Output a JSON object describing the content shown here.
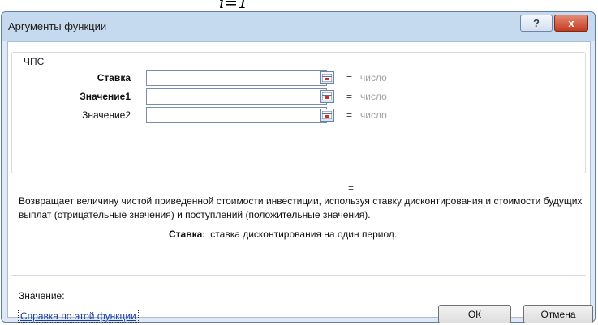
{
  "top_fragment": "i=1",
  "window": {
    "title": "Аргументы функции",
    "help_label": "?",
    "close_label": "x"
  },
  "function_group": {
    "name": "ЧПС",
    "arguments": [
      {
        "label": "Ставка",
        "value": "",
        "result": "число"
      },
      {
        "label": "Значение1",
        "value": "",
        "result": "число"
      },
      {
        "label": "Значение2",
        "value": "",
        "result": "число"
      }
    ],
    "equals": "="
  },
  "result_equals": "=",
  "description": "Возвращает величину чистой приведенной стоимости инвестиции, используя ставку дисконтирования и стоимости будущих выплат (отрицательные значения) и поступлений (положительные значения).",
  "argument_help": {
    "name": "Ставка:",
    "text": "ставка дисконтирования на один период."
  },
  "value_label": "Значение:",
  "help_link": "Справка по этой функции",
  "buttons": {
    "ok": "ОК",
    "cancel": "Отмена"
  }
}
